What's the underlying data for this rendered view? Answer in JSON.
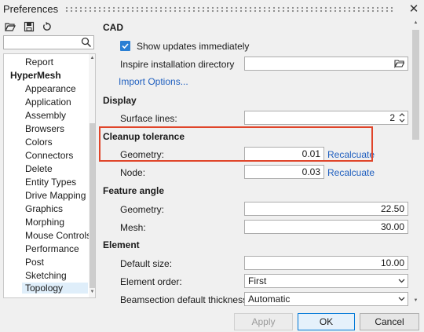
{
  "window": {
    "title": "Preferences"
  },
  "search": {
    "placeholder": "",
    "value": ""
  },
  "tree": {
    "items": [
      {
        "label": "Report",
        "level": 1
      },
      {
        "label": "HyperMesh",
        "level": 0
      },
      {
        "label": "Appearance",
        "level": 1
      },
      {
        "label": "Application",
        "level": 1
      },
      {
        "label": "Assembly",
        "level": 1
      },
      {
        "label": "Browsers",
        "level": 1
      },
      {
        "label": "Colors",
        "level": 1
      },
      {
        "label": "Connectors",
        "level": 1
      },
      {
        "label": "Delete",
        "level": 1
      },
      {
        "label": "Entity Types",
        "level": 1
      },
      {
        "label": "Drive Mapping",
        "level": 1
      },
      {
        "label": "Graphics",
        "level": 1
      },
      {
        "label": "Morphing",
        "level": 1
      },
      {
        "label": "Mouse Controls",
        "level": 1
      },
      {
        "label": "Performance",
        "level": 1
      },
      {
        "label": "Post",
        "level": 1
      },
      {
        "label": "Sketching",
        "level": 1
      },
      {
        "label": "Topology",
        "level": 1,
        "selected": true
      }
    ]
  },
  "cad": {
    "heading": "CAD",
    "show_updates_label": "Show updates immediately",
    "show_updates_checked": true,
    "install_dir_label": "Inspire installation directory",
    "install_dir_value": "",
    "import_options_link": "Import Options..."
  },
  "display": {
    "heading": "Display",
    "surface_lines_label": "Surface lines:",
    "surface_lines_value": "2"
  },
  "cleanup": {
    "heading": "Cleanup tolerance",
    "geometry_label": "Geometry:",
    "geometry_value": "0.01",
    "node_label": "Node:",
    "node_value": "0.03",
    "recalculate_link": "Recalcuate"
  },
  "feature_angle": {
    "heading": "Feature angle",
    "geometry_label": "Geometry:",
    "geometry_value": "22.50",
    "mesh_label": "Mesh:",
    "mesh_value": "30.00"
  },
  "element": {
    "heading": "Element",
    "default_size_label": "Default size:",
    "default_size_value": "10.00",
    "element_order_label": "Element order:",
    "element_order_value": "First",
    "beamsection_label": "Beamsection default thickness:",
    "beamsection_value": "Automatic"
  },
  "footer": {
    "apply_label": "Apply",
    "ok_label": "OK",
    "cancel_label": "Cancel"
  },
  "icons": {
    "open": "folder-open-icon",
    "save": "save-icon",
    "reset": "reset-icon",
    "search": "search-icon",
    "close": "close-icon"
  },
  "colors": {
    "accent": "#2a7fd4",
    "link": "#1f5fbf",
    "highlight": "#e0452a"
  }
}
